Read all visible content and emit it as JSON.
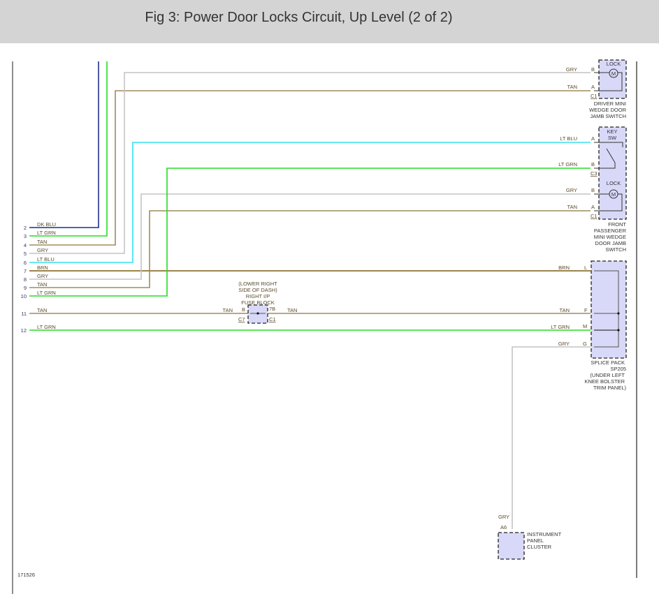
{
  "title": "Fig 3: Power Door Locks Circuit, Up Level (2 of 2)",
  "diagram_id": "171526",
  "colors": {
    "dk_blu": "#1a2f8a",
    "lt_grn": "#22dd22",
    "tan": "#a08c5a",
    "gry": "#c4c4c4",
    "lt_blu": "#33e0f0",
    "brn": "#7a5a10"
  },
  "left_wires": [
    {
      "num": "2",
      "label": "DK BLU"
    },
    {
      "num": "3",
      "label": "LT GRN"
    },
    {
      "num": "4",
      "label": "TAN"
    },
    {
      "num": "5",
      "label": "GRY"
    },
    {
      "num": "6",
      "label": "LT BLU"
    },
    {
      "num": "7",
      "label": "BRN"
    },
    {
      "num": "8",
      "label": "GRY"
    },
    {
      "num": "9",
      "label": "TAN"
    },
    {
      "num": "10",
      "label": "LT GRN"
    },
    {
      "num": "11",
      "label": "TAN"
    },
    {
      "num": "12",
      "label": "LT GRN"
    }
  ],
  "driver_switch": {
    "lock": "LOCK",
    "motor": "M",
    "pins": [
      {
        "wire": "GRY",
        "pin": "B"
      },
      {
        "wire": "TAN",
        "pin": "A"
      }
    ],
    "connector": "C1",
    "name": [
      "DRIVER MINI",
      "WEDGE DOOR",
      "JAMB SWITCH"
    ]
  },
  "passenger_switch": {
    "key": [
      "KEY",
      "SW"
    ],
    "key_pins": [
      {
        "wire": "LT BLU",
        "pin": "A"
      },
      {
        "wire": "LT GRN",
        "pin": "B"
      }
    ],
    "key_connector": "C3",
    "lock": "LOCK",
    "motor": "M",
    "lock_pins": [
      {
        "wire": "GRY",
        "pin": "B"
      },
      {
        "wire": "TAN",
        "pin": "A"
      }
    ],
    "lock_connector": "C1",
    "name": [
      "FRONT",
      "PASSENGER",
      "MINI WEDGE",
      "DOOR JAMB",
      "SWITCH"
    ]
  },
  "splice_pack": {
    "pins": [
      {
        "wire": "BRN",
        "pin": "L"
      },
      {
        "wire": "TAN",
        "pin": "F"
      },
      {
        "wire": "LT GRN",
        "pin": "M"
      },
      {
        "wire": "GRY",
        "pin": "G"
      }
    ],
    "name": [
      "SPLICE PACK",
      "SP205",
      "(UNDER LEFT",
      "KNEE BOLSTER",
      "TRIM PANEL)"
    ]
  },
  "fuse_block": {
    "name": [
      "(LOWER RIGHT",
      "SIDE OF DASH)",
      "RIGHT I/P",
      "FUSE BLOCK"
    ],
    "in_wire": "TAN",
    "in_pin": "B",
    "in_conn": "C7",
    "out_pin": "7B",
    "out_conn": "C1",
    "out_wire": "TAN"
  },
  "cluster": {
    "wire": "GRY",
    "pin": "A6",
    "name": [
      "INSTRUMENT",
      "PANEL",
      "CLUSTER"
    ]
  }
}
